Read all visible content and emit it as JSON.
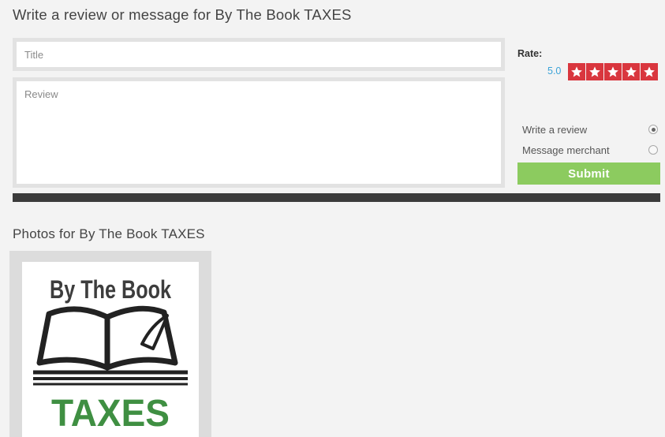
{
  "review_form": {
    "heading": "Write a review or message for By The Book TAXES",
    "title_placeholder": "Title",
    "review_placeholder": "Review",
    "rate_label": "Rate:",
    "rating_value": "5.0",
    "stars_filled": 5,
    "stars_total": 5,
    "options": [
      {
        "label": "Write a review",
        "selected": true
      },
      {
        "label": "Message merchant",
        "selected": false
      }
    ],
    "submit_label": "Submit",
    "colors": {
      "stars": "#d9363e",
      "submit": "#8ccb5f",
      "rating_value": "#3aa3d8",
      "divider": "#3b3b3b"
    }
  },
  "photos": {
    "heading": "Photos for By The Book TAXES",
    "items": [
      {
        "logo_line1": "By The Book",
        "logo_line2": "TAXES",
        "icon": "open-book-icon"
      }
    ]
  }
}
